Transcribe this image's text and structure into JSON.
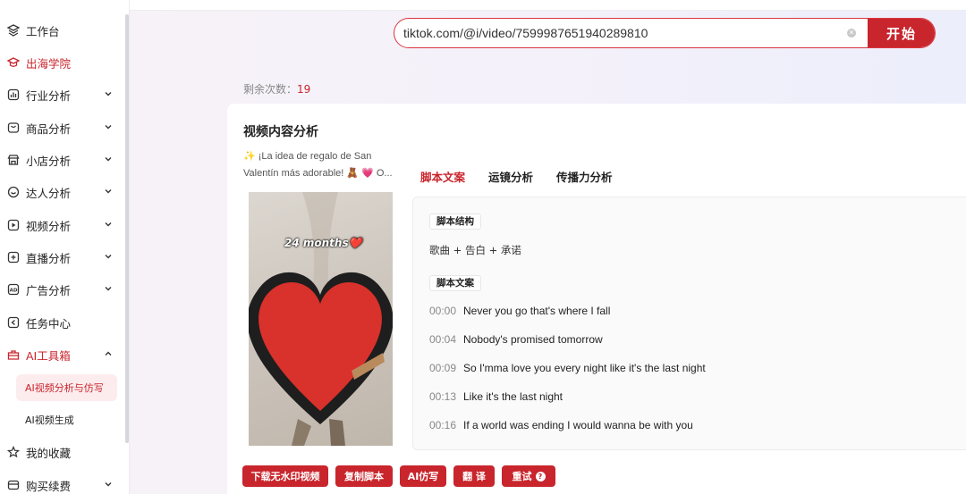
{
  "sidebar": {
    "items": [
      {
        "label": "工作台",
        "icon": "workbench-icon"
      },
      {
        "label": "出海学院",
        "icon": "graduation-cap-icon"
      },
      {
        "label": "行业分析",
        "icon": "industry-chart-icon"
      },
      {
        "label": "商品分析",
        "icon": "product-box-icon"
      },
      {
        "label": "小店分析",
        "icon": "shop-icon"
      },
      {
        "label": "达人分析",
        "icon": "smile-face-icon"
      },
      {
        "label": "视频分析",
        "icon": "video-play-icon"
      },
      {
        "label": "直播分析",
        "icon": "live-stream-icon"
      },
      {
        "label": "广告分析",
        "icon": "ad-icon"
      },
      {
        "label": "任务中心",
        "icon": "task-icon"
      },
      {
        "label": "AI工具箱",
        "icon": "ai-toolbox-icon"
      },
      {
        "label": "我的收藏",
        "icon": "star-icon"
      },
      {
        "label": "购买续费",
        "icon": "wallet-icon"
      }
    ],
    "sub_items": [
      {
        "label": "AI视频分析与仿写"
      },
      {
        "label": "AI视频生成"
      }
    ]
  },
  "search": {
    "value": "tiktok.com/@i/video/7599987651940289810",
    "start_label": "开始"
  },
  "remaining": {
    "label": "剩余次数：",
    "count": "19"
  },
  "card": {
    "title": "视频内容分析",
    "description": "✨ ¡La idea de regalo de San Valentín más adorable! 🧸 💗 O...",
    "thumbnail_text": "24 months❤️",
    "tabs": [
      "脚本文案",
      "运镜分析",
      "传播力分析"
    ],
    "structure_tag": "脚本结构",
    "structure_value": "歌曲 + 告白 + 承诺",
    "script_tag": "脚本文案",
    "lines": [
      {
        "time": "00:00",
        "text": "Never you go that's where I fall"
      },
      {
        "time": "00:04",
        "text": "Nobody's promised tomorrow"
      },
      {
        "time": "00:09",
        "text": "So I'mma love you every night like it's the last night"
      },
      {
        "time": "00:13",
        "text": "Like it's the last night"
      },
      {
        "time": "00:16",
        "text": "If a world was ending I would wanna be with you"
      }
    ],
    "buttons": [
      "下载无水印视频",
      "复制脚本",
      "AI仿写",
      "翻 译",
      "重试"
    ]
  },
  "colors": {
    "accent": "#c9252c"
  }
}
